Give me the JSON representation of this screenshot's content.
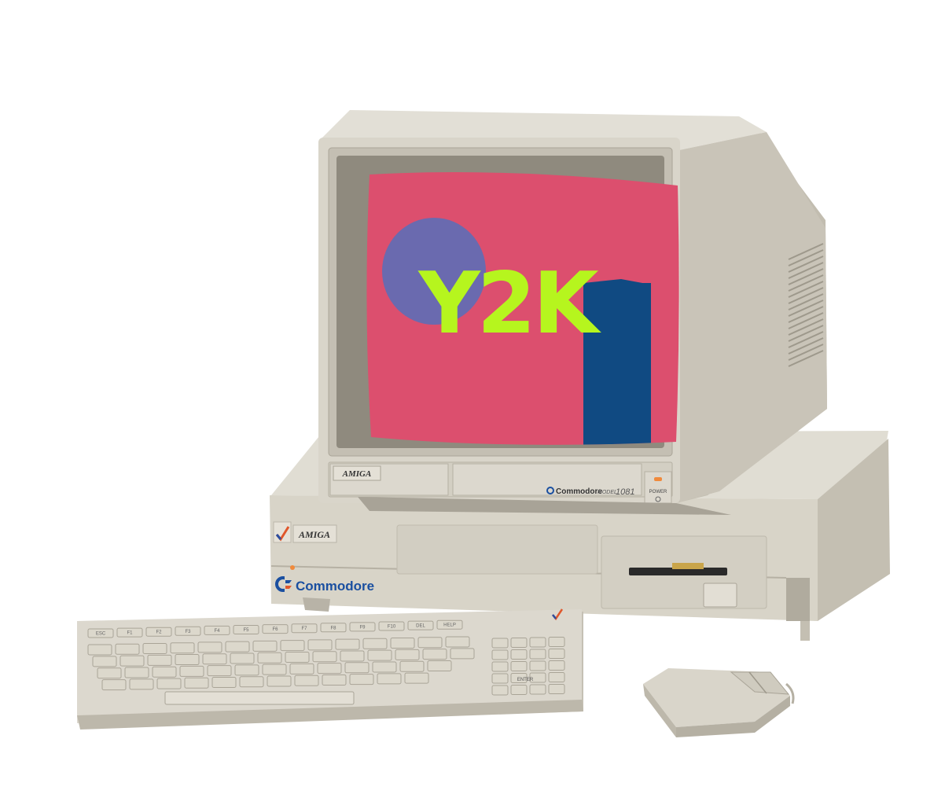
{
  "screen": {
    "headline": "Y2K",
    "colors": {
      "background": "#dc4f6e",
      "circle": "#6a6aaf",
      "block": "#104a82",
      "text": "#b6f51e"
    }
  },
  "monitor": {
    "badge": "AMIGA",
    "brand": "Commodore",
    "model_prefix": "MODEL",
    "model_number": "1081",
    "power_label": "POWER",
    "power_led": "#f08a3c"
  },
  "base_unit": {
    "badge": "AMIGA",
    "brand": "Commodore",
    "brand_color": "#1a4fa0"
  },
  "keyboard": {
    "function_keys": [
      "ESC",
      "F1",
      "F2",
      "F3",
      "F4",
      "F5",
      "F6",
      "F7",
      "F8",
      "F9",
      "F10",
      "DEL",
      "HELP"
    ],
    "enter_label": "ENTER"
  },
  "mouse": {},
  "palette": {
    "case": "#d6d2c6",
    "case_dark": "#b9b4a8",
    "case_light": "#e8e5dc",
    "key": "#dcd8cc"
  }
}
